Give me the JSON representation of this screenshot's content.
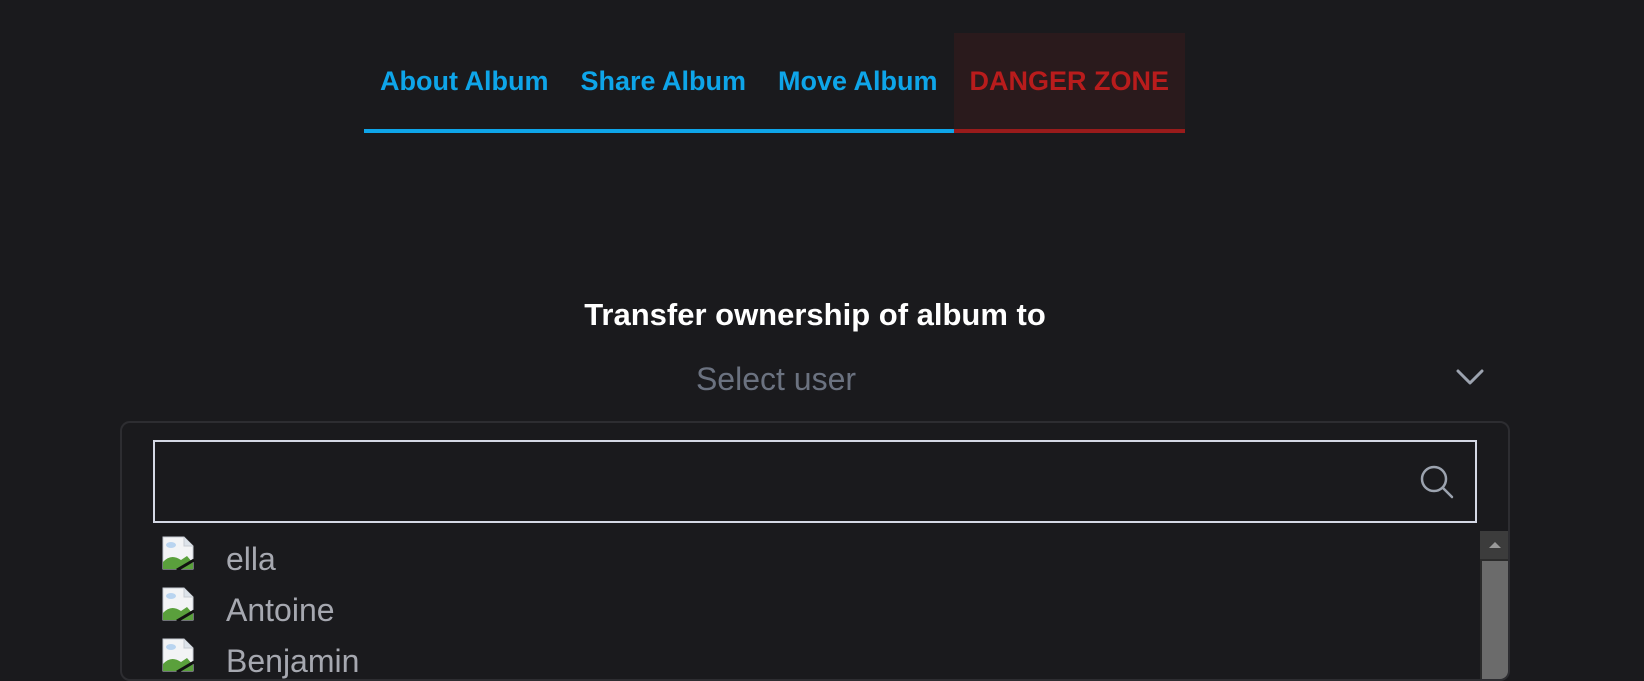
{
  "tabs": {
    "about": "About Album",
    "share": "Share Album",
    "move": "Move Album",
    "danger": "DANGER ZONE"
  },
  "transfer": {
    "title": "Transfer ownership of album to",
    "select_placeholder": "Select user",
    "search_value": ""
  },
  "users": [
    {
      "name": "ella",
      "avatar_icon": "broken-image-icon"
    },
    {
      "name": "Antoine",
      "avatar_icon": "broken-image-icon"
    },
    {
      "name": "Benjamin",
      "avatar_icon": "broken-image-icon"
    }
  ],
  "colors": {
    "accent": "#0ea5e9",
    "danger": "#b91c1c",
    "background": "#1a1a1d"
  }
}
